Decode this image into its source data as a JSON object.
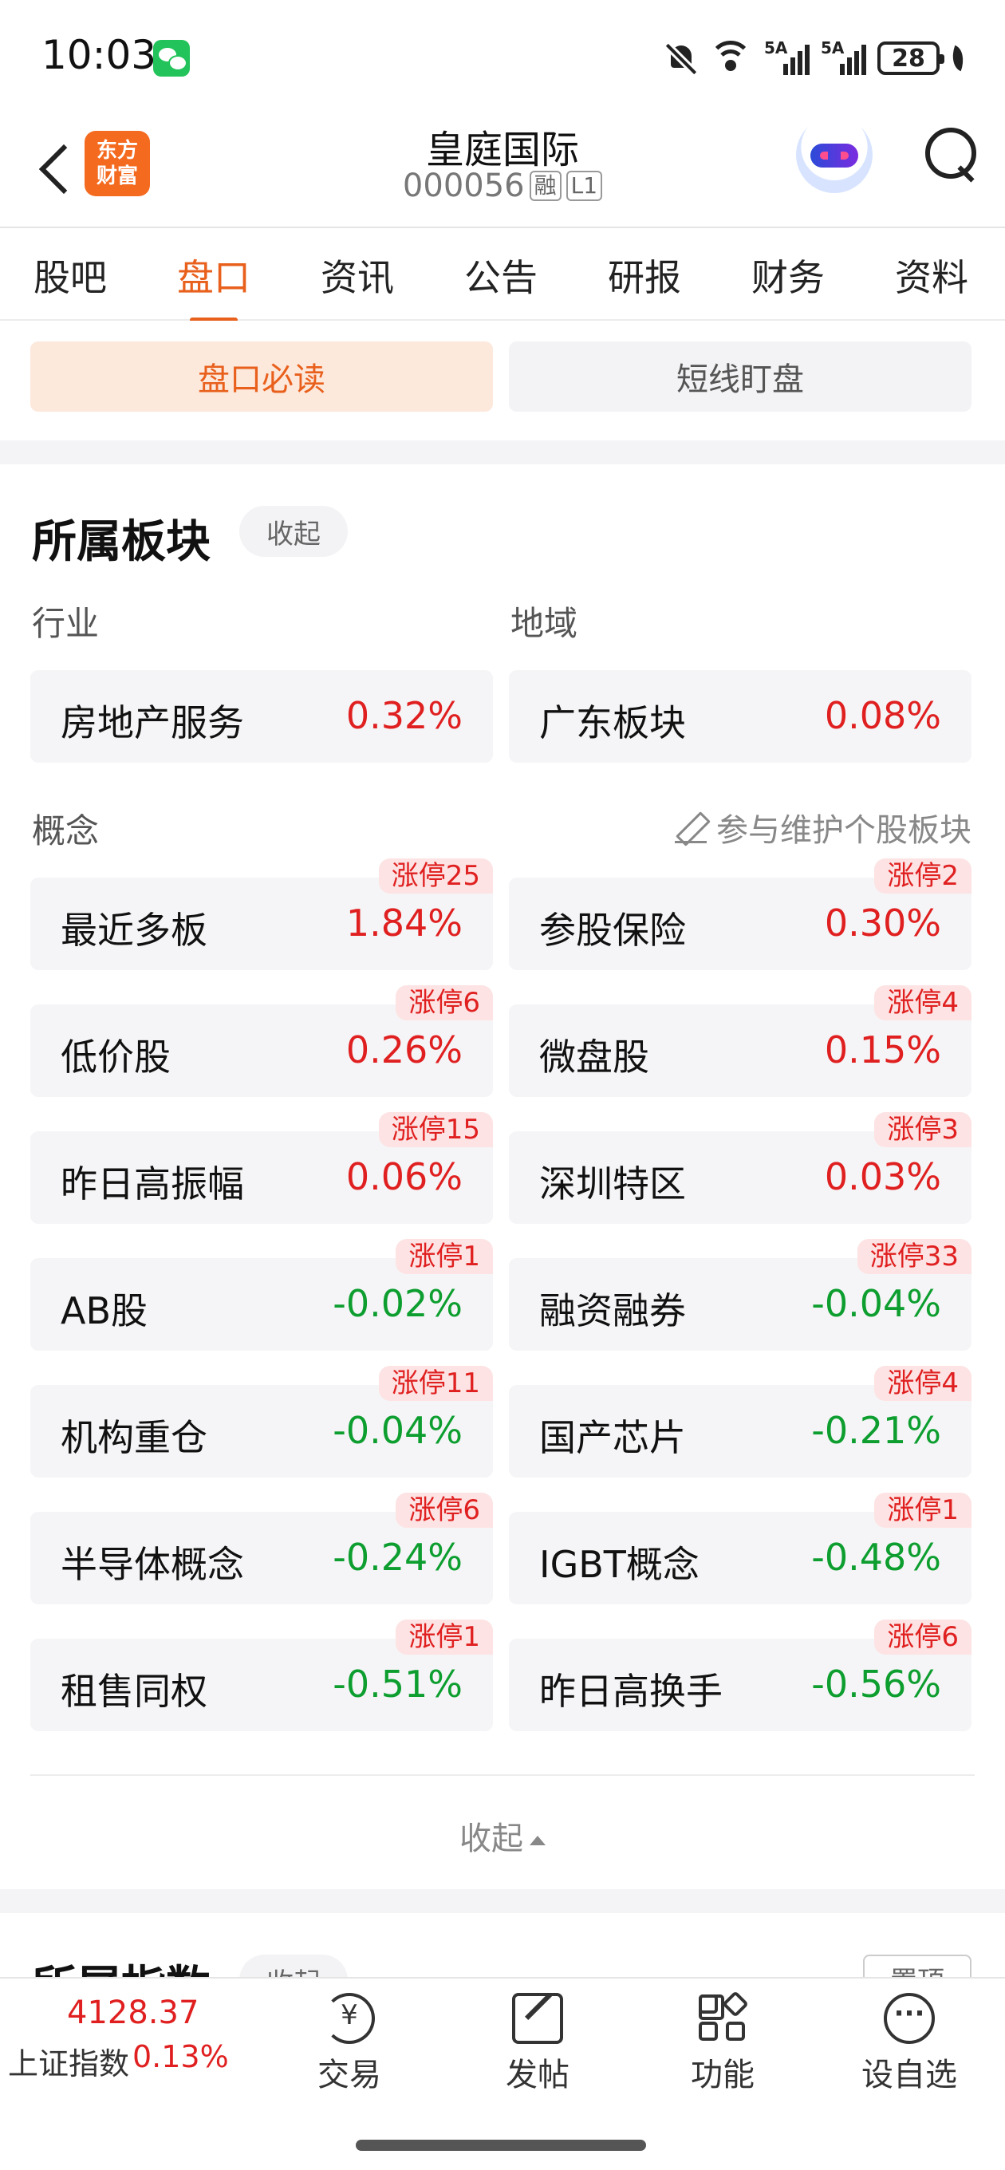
{
  "status_bar": {
    "time": "10:03",
    "signal1_label": "5A",
    "signal2_label": "5A",
    "battery": "28"
  },
  "header": {
    "logo_text": "东方\n财富",
    "stock_name": "皇庭国际",
    "stock_code": "000056",
    "badge_margin": "融",
    "badge_level": "L1"
  },
  "tabs": [
    {
      "label": "股吧",
      "active": false
    },
    {
      "label": "盘口",
      "active": true
    },
    {
      "label": "资讯",
      "active": false
    },
    {
      "label": "公告",
      "active": false
    },
    {
      "label": "研报",
      "active": false
    },
    {
      "label": "财务",
      "active": false
    },
    {
      "label": "资料",
      "active": false
    }
  ],
  "subtabs": {
    "active": "盘口必读",
    "inactive": "短线盯盘"
  },
  "sector_card": {
    "title": "所属板块",
    "collapse_label": "收起",
    "industry_label": "行业",
    "region_label": "地域",
    "industry": {
      "name": "房地产服务",
      "pct": "0.32%",
      "dir": "up"
    },
    "region": {
      "name": "广东板块",
      "pct": "0.08%",
      "dir": "up"
    },
    "concept_label": "概念",
    "maintain_label": "参与维护个股板块",
    "concepts": [
      {
        "name": "最近多板",
        "pct": "1.84%",
        "dir": "up",
        "limit": "涨停25"
      },
      {
        "name": "参股保险",
        "pct": "0.30%",
        "dir": "up",
        "limit": "涨停2"
      },
      {
        "name": "低价股",
        "pct": "0.26%",
        "dir": "up",
        "limit": "涨停6"
      },
      {
        "name": "微盘股",
        "pct": "0.15%",
        "dir": "up",
        "limit": "涨停4"
      },
      {
        "name": "昨日高振幅",
        "pct": "0.06%",
        "dir": "up",
        "limit": "涨停15"
      },
      {
        "name": "深圳特区",
        "pct": "0.03%",
        "dir": "up",
        "limit": "涨停3"
      },
      {
        "name": "AB股",
        "pct": "-0.02%",
        "dir": "down",
        "limit": "涨停1"
      },
      {
        "name": "融资融券",
        "pct": "-0.04%",
        "dir": "down",
        "limit": "涨停33"
      },
      {
        "name": "机构重仓",
        "pct": "-0.04%",
        "dir": "down",
        "limit": "涨停11"
      },
      {
        "name": "国产芯片",
        "pct": "-0.21%",
        "dir": "down",
        "limit": "涨停4"
      },
      {
        "name": "半导体概念",
        "pct": "-0.24%",
        "dir": "down",
        "limit": "涨停6"
      },
      {
        "name": "IGBT概念",
        "pct": "-0.48%",
        "dir": "down",
        "limit": "涨停1"
      },
      {
        "name": "租售同权",
        "pct": "-0.51%",
        "dir": "down",
        "limit": "涨停1"
      },
      {
        "name": "昨日高换手",
        "pct": "-0.56%",
        "dir": "down",
        "limit": "涨停6"
      }
    ],
    "collapse_bottom_label": "收起"
  },
  "index_card": {
    "title": "所属指数",
    "collapse_label": "收起",
    "pin_label": "置顶"
  },
  "bottom_bar": {
    "index_value": "4128.37",
    "index_name": "上证指数",
    "index_change": "0.13%",
    "nav": [
      {
        "label": "交易",
        "icon": "trade-icon"
      },
      {
        "label": "发帖",
        "icon": "post-icon"
      },
      {
        "label": "功能",
        "icon": "function-icon"
      },
      {
        "label": "设自选",
        "icon": "add-watchlist-icon"
      }
    ]
  },
  "colors": {
    "accent": "#e8601c",
    "up": "#e02020",
    "down": "#0d9e2f"
  }
}
